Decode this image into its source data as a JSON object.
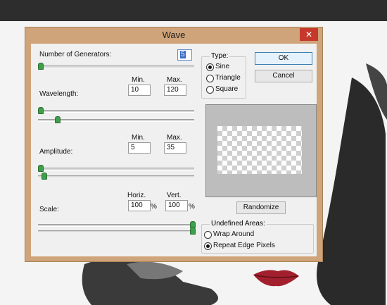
{
  "dialog": {
    "title": "Wave",
    "close_glyph": "✕",
    "close_icon": "close-icon"
  },
  "generators": {
    "label": "Number of Generators:",
    "value": "5",
    "slider_fraction": 0.0
  },
  "headers": {
    "min": "Min.",
    "max": "Max.",
    "horiz": "Horiz.",
    "vert": "Vert."
  },
  "wavelength": {
    "label": "Wavelength:",
    "min": "10",
    "max": "120",
    "min_slider": 0.0,
    "max_slider": 0.12
  },
  "amplitude": {
    "label": "Amplitude:",
    "min": "5",
    "max": "35",
    "min_slider": 0.0,
    "max_slider": 0.04
  },
  "scale": {
    "label": "Scale:",
    "horiz": "100",
    "vert": "100",
    "unit": "%",
    "horiz_slider": 1.0,
    "vert_slider": 1.0
  },
  "type": {
    "label": "Type:",
    "options": [
      "Sine",
      "Triangle",
      "Square"
    ],
    "selected": "Sine"
  },
  "buttons": {
    "ok": "OK",
    "cancel": "Cancel",
    "randomize": "Randomize"
  },
  "undefined_areas": {
    "label": "Undefined Areas:",
    "options": [
      "Wrap Around",
      "Repeat Edge Pixels"
    ],
    "selected": "Repeat Edge Pixels"
  },
  "colors": {
    "title_bar": "#cfa47a",
    "close": "#c6372c",
    "slider_thumb": "#3da04a"
  }
}
